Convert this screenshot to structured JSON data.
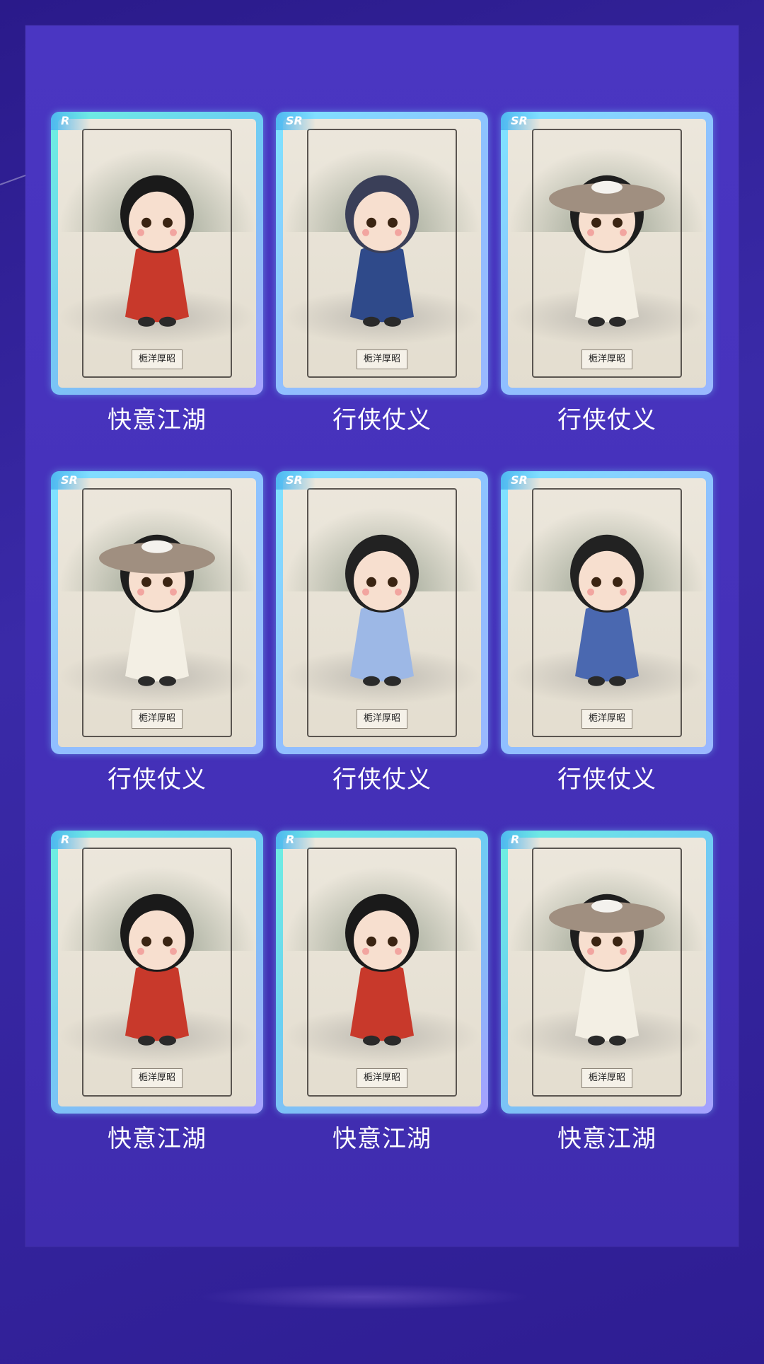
{
  "cards": [
    {
      "rarity": "R",
      "name": "快意江湖",
      "variant": "red"
    },
    {
      "rarity": "SR",
      "name": "行侠仗义",
      "variant": "navy"
    },
    {
      "rarity": "SR",
      "name": "行侠仗义",
      "variant": "hat"
    },
    {
      "rarity": "SR",
      "name": "行侠仗义",
      "variant": "hat"
    },
    {
      "rarity": "SR",
      "name": "行侠仗义",
      "variant": "lightblue"
    },
    {
      "rarity": "SR",
      "name": "行侠仗义",
      "variant": "blue"
    },
    {
      "rarity": "R",
      "name": "快意江湖",
      "variant": "red"
    },
    {
      "rarity": "R",
      "name": "快意江湖",
      "variant": "red"
    },
    {
      "rarity": "R",
      "name": "快意江湖",
      "variant": "hat"
    }
  ],
  "logo_text": "栀洋厚昭",
  "colors": {
    "background": "#3a2aa8",
    "panel": "#4532b8",
    "card_border_r": "#6ff0e0",
    "card_border_sr": "#8fc0ff"
  }
}
